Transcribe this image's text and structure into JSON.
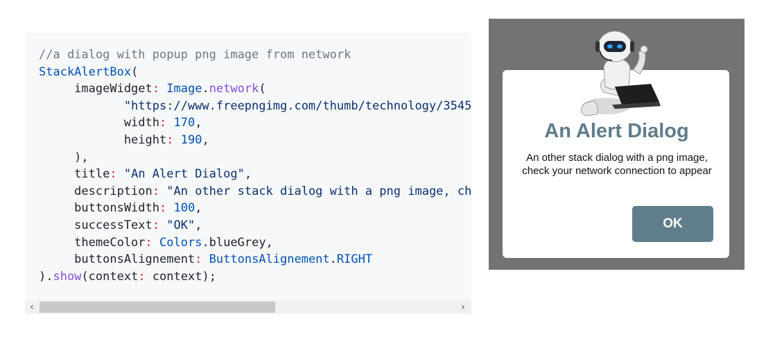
{
  "code_block": {
    "lines": [
      [
        {
          "t": "//a dialog with popup png image from network",
          "c": "comment"
        }
      ],
      [
        {
          "t": "StackAlertBox",
          "c": "fn"
        },
        {
          "t": "(",
          "c": "plain"
        }
      ],
      [
        {
          "t": "     imageWidget",
          "c": "key"
        },
        {
          "t": ":",
          "c": "colon"
        },
        {
          "t": " Image",
          "c": "fn"
        },
        {
          "t": ".",
          "c": "plain"
        },
        {
          "t": "network",
          "c": "purple"
        },
        {
          "t": "(",
          "c": "plain"
        }
      ],
      [
        {
          "t": "            \"https://www.freepngimg.com/thumb/technology/3545",
          "c": "str"
        }
      ],
      [
        {
          "t": "            width",
          "c": "key"
        },
        {
          "t": ":",
          "c": "colon"
        },
        {
          "t": " 170",
          "c": "num"
        },
        {
          "t": ",",
          "c": "plain"
        }
      ],
      [
        {
          "t": "            height",
          "c": "key"
        },
        {
          "t": ":",
          "c": "colon"
        },
        {
          "t": " 190",
          "c": "num"
        },
        {
          "t": ",",
          "c": "plain"
        }
      ],
      [
        {
          "t": "     ),",
          "c": "plain"
        }
      ],
      [
        {
          "t": "     title",
          "c": "key"
        },
        {
          "t": ":",
          "c": "colon"
        },
        {
          "t": " \"An Alert Dialog\"",
          "c": "str"
        },
        {
          "t": ",",
          "c": "plain"
        }
      ],
      [
        {
          "t": "     description",
          "c": "key"
        },
        {
          "t": ":",
          "c": "colon"
        },
        {
          "t": " \"An other stack dialog with a png image, ch",
          "c": "str"
        }
      ],
      [
        {
          "t": "     buttonsWidth",
          "c": "key"
        },
        {
          "t": ":",
          "c": "colon"
        },
        {
          "t": " 100",
          "c": "num"
        },
        {
          "t": ",",
          "c": "plain"
        }
      ],
      [
        {
          "t": "     successText",
          "c": "key"
        },
        {
          "t": ":",
          "c": "colon"
        },
        {
          "t": " \"OK\"",
          "c": "str"
        },
        {
          "t": ",",
          "c": "plain"
        }
      ],
      [
        {
          "t": "     themeColor",
          "c": "key"
        },
        {
          "t": ":",
          "c": "colon"
        },
        {
          "t": " Colors",
          "c": "fn"
        },
        {
          "t": ".blueGrey,",
          "c": "plain"
        }
      ],
      [
        {
          "t": "     buttonsAlignement",
          "c": "key"
        },
        {
          "t": ":",
          "c": "colon"
        },
        {
          "t": " ButtonsAlignement",
          "c": "fn"
        },
        {
          "t": ".",
          "c": "plain"
        },
        {
          "t": "RIGHT",
          "c": "fn"
        }
      ],
      [
        {
          "t": ").",
          "c": "plain"
        },
        {
          "t": "show",
          "c": "purple"
        },
        {
          "t": "(context",
          "c": "plain"
        },
        {
          "t": ":",
          "c": "colon"
        },
        {
          "t": " context);",
          "c": "plain"
        }
      ]
    ],
    "scroll_left_icon": "chevron-left-icon",
    "scroll_right_icon": "chevron-right-icon",
    "scroll_left_glyph": "‹",
    "scroll_right_glyph": "›"
  },
  "dialog_preview": {
    "image_icon": "robot-with-laptop-icon",
    "title": "An Alert Dialog",
    "description": "An other stack dialog with a png image, check your network connection to appear",
    "ok_label": "OK",
    "theme_color": "#607d8b",
    "backdrop_color": "#737373"
  }
}
